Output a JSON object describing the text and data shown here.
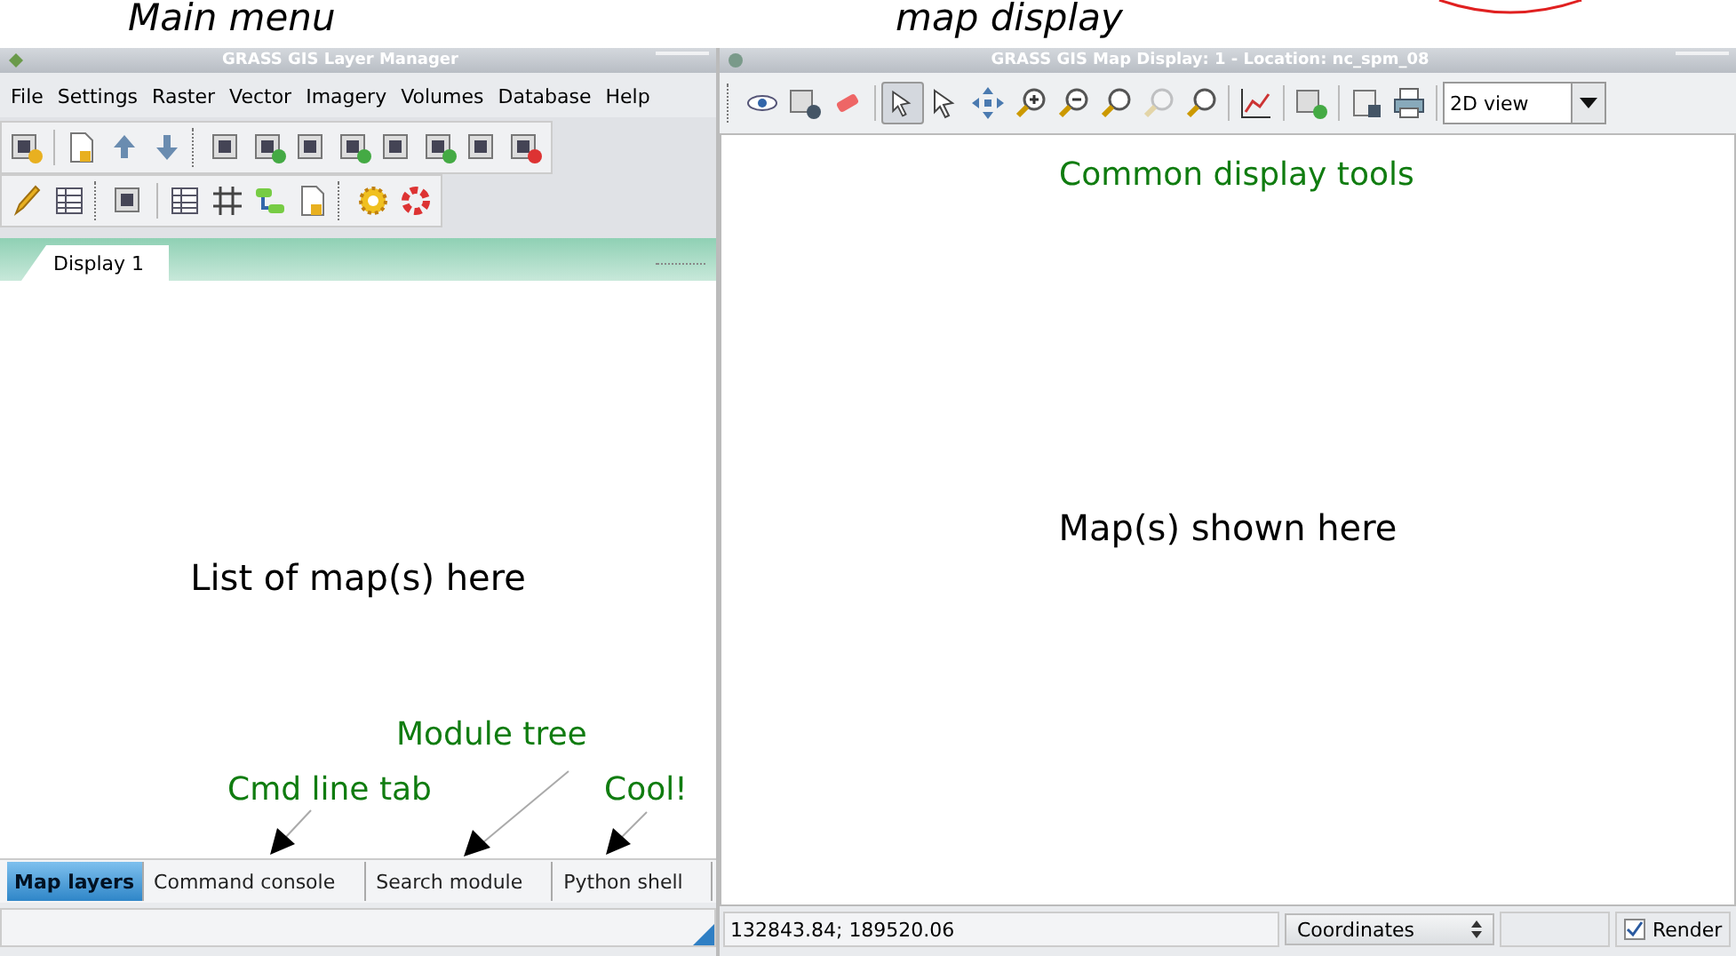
{
  "captions": {
    "left": "Main menu",
    "right": "map display"
  },
  "layer_manager": {
    "title": "GRASS GIS Layer Manager",
    "menu": [
      "File",
      "Settings",
      "Raster",
      "Vector",
      "Imagery",
      "Volumes",
      "Database",
      "Help"
    ],
    "display_tabs": [
      {
        "label": "Display 1",
        "selected": true
      }
    ],
    "list_note": "List of map(s) here",
    "bottom_tabs": [
      {
        "label": "Map layers",
        "selected": true
      },
      {
        "label": "Command console",
        "selected": false
      },
      {
        "label": "Search module",
        "selected": false
      },
      {
        "label": "Python shell",
        "selected": false
      }
    ]
  },
  "annotations": {
    "module_tree": "Module tree",
    "cmd_line": "Cmd line tab",
    "cool": "Cool!",
    "display_tools": "Common display tools"
  },
  "map_display": {
    "title": "GRASS GIS Map Display: 1  - Location: nc_spm_08",
    "tools": [
      {
        "selected": false,
        "disabled": false
      },
      {
        "selected": false,
        "disabled": false
      },
      {
        "selected": false,
        "disabled": false
      },
      {
        "selected": true,
        "disabled": false
      },
      {
        "selected": false,
        "disabled": false
      },
      {
        "selected": false,
        "disabled": false
      },
      {
        "selected": false,
        "disabled": false
      },
      {
        "selected": false,
        "disabled": false
      },
      {
        "selected": false,
        "disabled": false
      },
      {
        "selected": false,
        "disabled": true
      },
      {
        "selected": false,
        "disabled": false
      },
      {
        "selected": false,
        "disabled": false
      },
      {
        "selected": false,
        "disabled": false
      },
      {
        "selected": false,
        "disabled": false
      },
      {
        "selected": false,
        "disabled": false
      }
    ],
    "view_mode": "2D view",
    "map_note": "Map(s) shown here",
    "coordinates": "132843.84; 189520.06",
    "status_mode": "Coordinates",
    "render": {
      "label": "Render",
      "checked": true
    }
  }
}
